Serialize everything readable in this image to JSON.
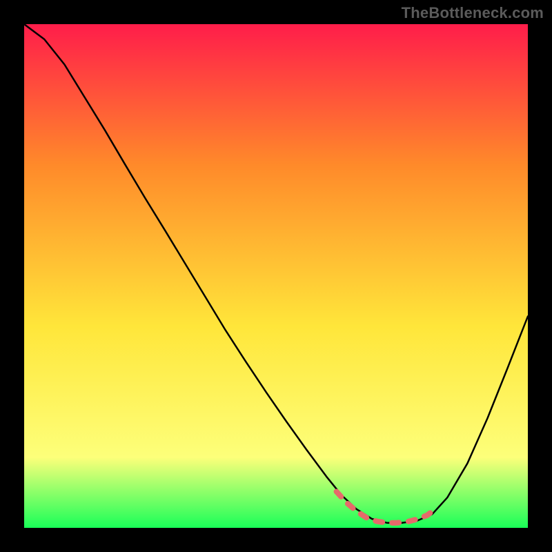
{
  "watermark": "TheBottleneck.com",
  "chart_data": {
    "type": "line",
    "title": "",
    "xlabel": "",
    "ylabel": "",
    "xlim": [
      0,
      1
    ],
    "ylim": [
      0,
      1
    ],
    "grid": false,
    "legend": false,
    "background_gradient": {
      "top": "#ff1d4a",
      "mid_upper": "#ff8a2a",
      "mid": "#ffe63a",
      "mid_lower": "#fdff7a",
      "bottom": "#19ff58"
    },
    "series": [
      {
        "name": "curve-main",
        "color": "#000000",
        "width": 2.5,
        "x": [
          0.0,
          0.04,
          0.08,
          0.12,
          0.16,
          0.2,
          0.24,
          0.28,
          0.32,
          0.36,
          0.4,
          0.44,
          0.48,
          0.52,
          0.56,
          0.6,
          0.63,
          0.66,
          0.69,
          0.72,
          0.75,
          0.78,
          0.81,
          0.84,
          0.88,
          0.92,
          0.96,
          1.0
        ],
        "y": [
          1.0,
          0.97,
          0.92,
          0.855,
          0.79,
          0.722,
          0.655,
          0.59,
          0.524,
          0.458,
          0.392,
          0.33,
          0.27,
          0.212,
          0.156,
          0.102,
          0.065,
          0.037,
          0.018,
          0.01,
          0.01,
          0.014,
          0.027,
          0.06,
          0.128,
          0.218,
          0.318,
          0.42
        ]
      },
      {
        "name": "curve-highlight",
        "color": "#e66a6a",
        "width": 8,
        "x": [
          0.62,
          0.64,
          0.66,
          0.68,
          0.7,
          0.72,
          0.74,
          0.76,
          0.78,
          0.8,
          0.82
        ],
        "y": [
          0.072,
          0.05,
          0.033,
          0.02,
          0.013,
          0.01,
          0.01,
          0.012,
          0.017,
          0.025,
          0.04
        ]
      }
    ]
  }
}
